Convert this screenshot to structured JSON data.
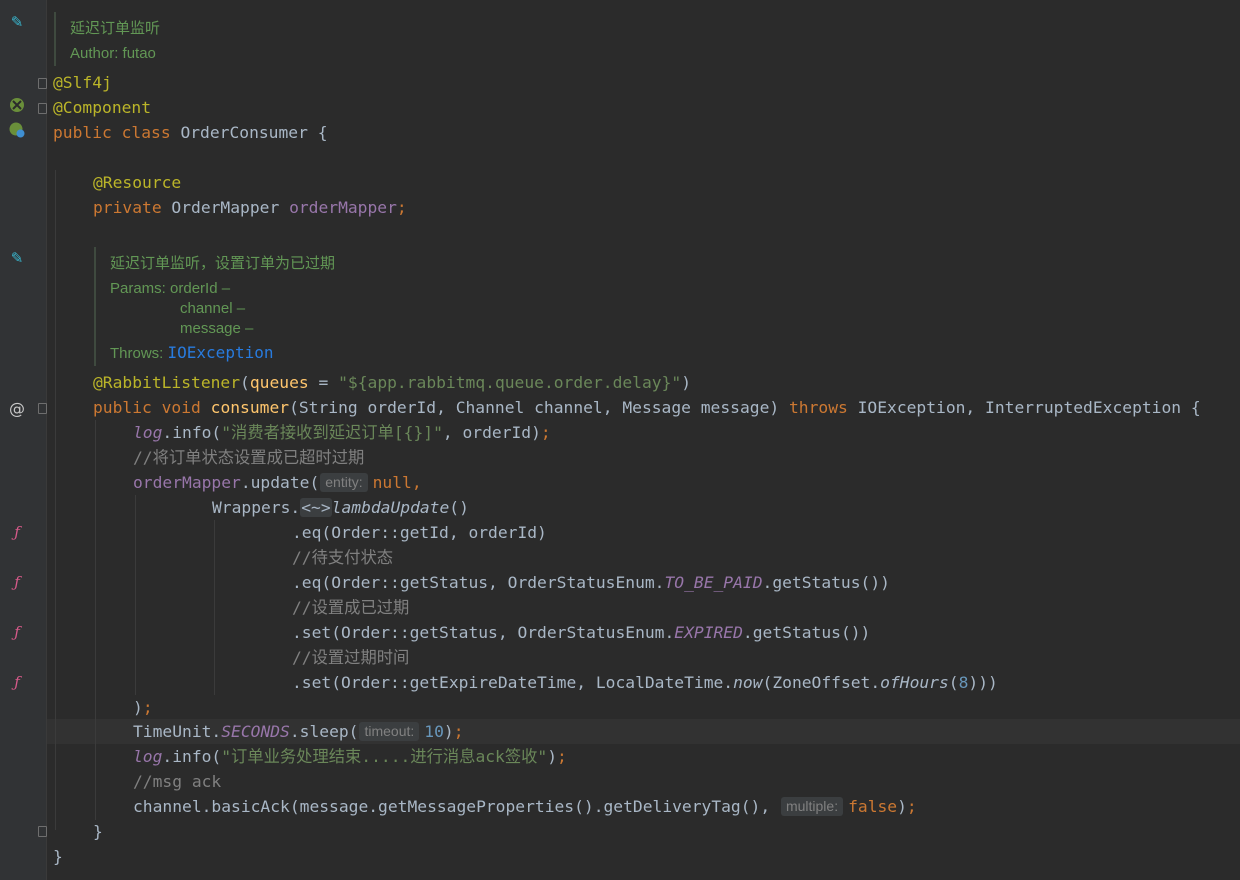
{
  "doc1": {
    "title": "延迟订单监听",
    "author": "Author: futao"
  },
  "class_decl": {
    "ann_slf4j": "@Slf4j",
    "ann_component": "@Component",
    "kw_public": "public ",
    "kw_class": "class ",
    "name": "OrderConsumer",
    "brace": " {"
  },
  "field": {
    "annotation": "@Resource",
    "kw_private": "private ",
    "type": "OrderMapper ",
    "name": "orderMapper",
    "semi": ";"
  },
  "doc2": {
    "desc": "延迟订单监听，设置订单为已过期",
    "params_label": "Params: ",
    "param1": "orderId –",
    "param2": "channel –",
    "param3": "message –",
    "throws_label": "Throws: ",
    "throws_type": "IOException"
  },
  "listener": {
    "annotation": "@RabbitListener",
    "open": "(",
    "attr": "queues",
    "eq": " = ",
    "value": "\"${app.rabbitmq.queue.order.delay}\"",
    "close": ")"
  },
  "method": {
    "kw_public": "public ",
    "kw_void": "void ",
    "name": "consumer",
    "params": "(String orderId, Channel channel, Message message) ",
    "kw_throws": "throws ",
    "exceptions": "IOException, InterruptedException {"
  },
  "body": {
    "l1_log": "log",
    "l1_info": ".info(",
    "l1_str": "\"消费者接收到延迟订单[{}]\"",
    "l1_rest": ", orderId)",
    "l1_semi": ";",
    "c1": "//将订单状态设置成已超时过期",
    "l2_field": "orderMapper",
    "l2_update": ".update(",
    "l2_hint": "entity:",
    "l2_null": "null",
    "l2_comma": ",",
    "l3_wrappers": "Wrappers.",
    "l3_diamond": "<~>",
    "l3_method": "lambdaUpdate",
    "l3_paren": "()",
    "l4": ".eq(Order::getId, orderId)",
    "c2": "//待支付状态",
    "l5_pre": ".eq(Order::getStatus, OrderStatusEnum.",
    "l5_const": "TO_BE_PAID",
    "l5_post": ".getStatus())",
    "c3": "//设置成已过期",
    "l6_pre": ".set(Order::getStatus, OrderStatusEnum.",
    "l6_const": "EXPIRED",
    "l6_post": ".getStatus())",
    "c4": "//设置过期时间",
    "l7_pre": ".set(Order::getExpireDateTime, LocalDateTime.",
    "l7_now": "now",
    "l7_mid": "(ZoneOffset.",
    "l7_ofhours": "ofHours",
    "l7_open": "(",
    "l7_num": "8",
    "l7_close": ")))",
    "l8_close": ")",
    "l8_semi": ";",
    "l9_pre": "TimeUnit.",
    "l9_const": "SECONDS",
    "l9_sleep": ".sleep(",
    "l9_hint": "timeout:",
    "l9_num": "10",
    "l9_close": ")",
    "l9_semi": ";",
    "l10_log": "log",
    "l10_info": ".info(",
    "l10_str": "\"订单业务处理结束.....进行消息ack签收\"",
    "l10_close": ")",
    "l10_semi": ";",
    "c5": "//msg ack",
    "l11_pre": "channel.basicAck(message.getMessageProperties().getDeliveryTag(),",
    "l11_hint": "multiple:",
    "l11_false": "false",
    "l11_close": ")",
    "l11_semi": ";",
    "method_close": "}",
    "class_close": "}"
  },
  "gutter_icons": {
    "edit": "pencil-icon",
    "bean": "spring-bean-icon",
    "bean_class": "spring-class-icon",
    "at": "at-sign-icon",
    "lambda": "lambda-icon",
    "fold": "fold-marker-icon"
  },
  "colors": {
    "background": "#2b2b2b",
    "keyword": "#cc7832",
    "annotation": "#bbb529",
    "field": "#9876aa",
    "method_decl": "#ffc66d",
    "string": "#6a8759",
    "number": "#6897bb",
    "comment": "#808080",
    "doc": "#629755",
    "text": "#a9b7c6"
  }
}
